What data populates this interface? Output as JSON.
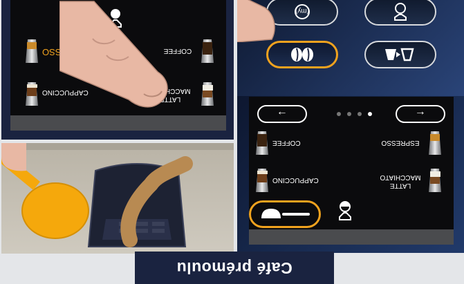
{
  "caption": "Café prémoulu",
  "colors": {
    "accent": "#f0a21e",
    "navy": "#1a2340",
    "screen": "#0b0b0d",
    "spoon": "#f5a80c"
  },
  "panel_a": {
    "products": [
      {
        "label": "LATTE\nMACCHIATO",
        "icon": "latte-cup-icon"
      },
      {
        "label": "CAPPUCCINO",
        "icon": "cappuccino-cup-icon"
      },
      {
        "label": "COFFEE",
        "icon": "coffee-cup-icon"
      },
      {
        "label": "ESPRESSO",
        "icon": "espresso-cup-icon"
      }
    ],
    "nav": {
      "prev": "←",
      "next": "→"
    }
  },
  "panel_b": {
    "buttons": [
      {
        "icon": "my-coffee-icon",
        "label": "(my)"
      },
      {
        "icon": "cup-dispense-icon",
        "label": ""
      },
      {
        "icon": "beans-icon",
        "label": ""
      },
      {
        "icon": "cup-transfer-icon",
        "label": ""
      }
    ]
  },
  "panel_c": {
    "icons": [
      "ground-coffee-spoon-icon",
      "coffee-chute-icon"
    ]
  },
  "panel_d": {
    "products": [
      {
        "label": "LATTE\nMACCHIATO",
        "icon": "latte-cup-icon"
      },
      {
        "label": "CAPPUCCINO",
        "icon": "cappuccino-cup-icon"
      },
      {
        "label": "ESPRESSO",
        "icon": "espresso-cup-icon"
      },
      {
        "label": "COFFEE",
        "icon": "coffee-cup-icon"
      }
    ],
    "nav": {
      "prev": "←",
      "next": "→"
    },
    "pager": {
      "active": 4,
      "count": 4
    }
  }
}
